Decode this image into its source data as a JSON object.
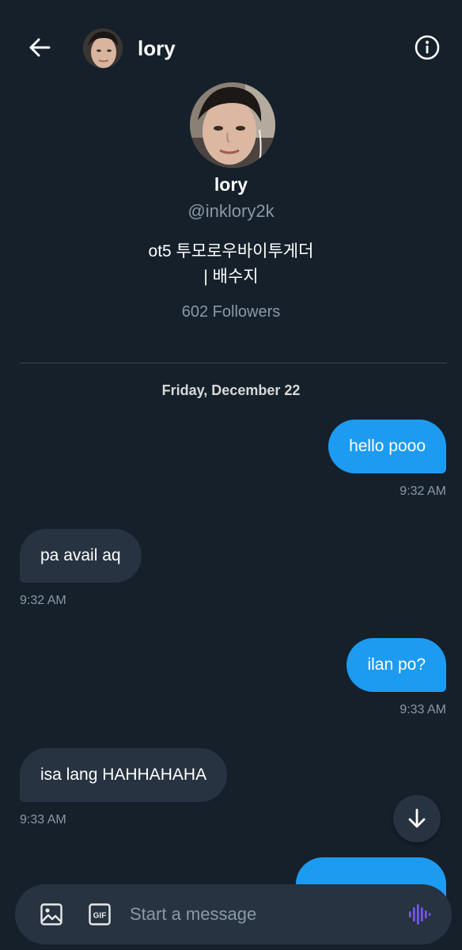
{
  "header": {
    "name": "lory",
    "back_icon": "arrow-left-icon",
    "info_icon": "info-circle-icon"
  },
  "profile": {
    "name": "lory",
    "handle": "@inklory2k",
    "bio_line1": "ot5 투모로우바이투게더",
    "bio_line2": "| 배수지",
    "followers": "602 Followers"
  },
  "date_label": "Friday, December 22",
  "messages": [
    {
      "direction": "sent",
      "text": "hello pooo",
      "time": "9:32 AM"
    },
    {
      "direction": "received",
      "text": "pa avail aq",
      "time": "9:32 AM"
    },
    {
      "direction": "sent",
      "text": "ilan po?",
      "time": "9:33 AM"
    },
    {
      "direction": "received",
      "text": "isa lang HAHHAHAHA",
      "time": "9:33 AM"
    },
    {
      "direction": "sent",
      "text": "",
      "time": ""
    }
  ],
  "composer": {
    "placeholder": "Start a message",
    "image_icon": "image-icon",
    "gif_icon": "gif-icon",
    "gif_label": "GIF",
    "voice_icon": "voice-waveform-icon"
  },
  "scroll_down_icon": "arrow-down-icon",
  "colors": {
    "background": "#15202b",
    "sent_bubble": "#1d9bf0",
    "received_bubble": "#273340",
    "secondary_text": "#8b98a5",
    "voice_accent": "#7856ff"
  }
}
